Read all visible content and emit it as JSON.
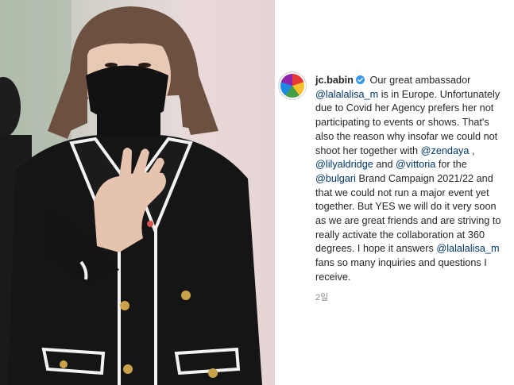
{
  "post": {
    "username": "jc.babin",
    "caption": [
      {
        "type": "text",
        "value": " Our great ambassador "
      },
      {
        "type": "mention",
        "value": "@lalalalisa_m"
      },
      {
        "type": "text",
        "value": " is in Europe. Unfortunately due to Covid her Agency prefers her not participating to events or shows. That's also the reason why insofar we could not shoot her together with "
      },
      {
        "type": "mention",
        "value": "@zendaya"
      },
      {
        "type": "text",
        "value": " , "
      },
      {
        "type": "mention",
        "value": "@lilyaldridge"
      },
      {
        "type": "text",
        "value": " and "
      },
      {
        "type": "mention",
        "value": "@vittoria"
      },
      {
        "type": "text",
        "value": " for the "
      },
      {
        "type": "mention",
        "value": "@bulgari"
      },
      {
        "type": "text",
        "value": " Brand Campaign 2021/22 and that we could not run a major event yet together. But YES we will do it very soon as we are great friends and are striving to really activate the collaboration at 360 degrees. I hope it answers "
      },
      {
        "type": "mention",
        "value": "@lalalalisa_m"
      },
      {
        "type": "text",
        "value": " fans so many inquiries and questions I receive."
      }
    ],
    "timestamp": "2일"
  },
  "icons": {
    "verified": "verified-badge-icon",
    "avatar": "profile-avatar"
  },
  "colors": {
    "mention": "#00376b",
    "text": "#262626",
    "muted": "#8e8e8e",
    "verified": "#3897f0"
  }
}
